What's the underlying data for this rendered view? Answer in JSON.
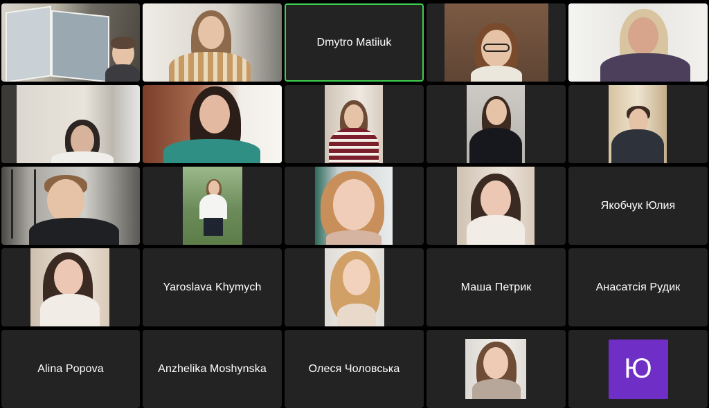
{
  "participants": {
    "p01": {
      "name": ""
    },
    "p02": {
      "name": ""
    },
    "p03": {
      "name": "Dmytro Matiiuk"
    },
    "p04": {
      "name": ""
    },
    "p05": {
      "name": ""
    },
    "p06": {
      "name": ""
    },
    "p07": {
      "name": ""
    },
    "p08": {
      "name": ""
    },
    "p09": {
      "name": ""
    },
    "p10": {
      "name": ""
    },
    "p11": {
      "name": ""
    },
    "p12": {
      "name": ""
    },
    "p13": {
      "name": ""
    },
    "p14": {
      "name": ""
    },
    "p15": {
      "name": "Якобчук Юлия"
    },
    "p16": {
      "name": ""
    },
    "p17": {
      "name": "Yaroslava Khymych"
    },
    "p18": {
      "name": ""
    },
    "p19": {
      "name": "Маша Петрик"
    },
    "p20": {
      "name": "Анасатсія Рудик"
    },
    "p21": {
      "name": "Alina Popova"
    },
    "p22": {
      "name": "Anzhelika Moshynska"
    },
    "p23": {
      "name": "Олеся Чоловська"
    },
    "p24": {
      "name": ""
    },
    "p25": {
      "name": "",
      "avatar_letter": "Ю",
      "avatar_color": "#6f2fc6"
    }
  },
  "colors": {
    "background": "#000000",
    "tile": "#232323",
    "active_speaker_border": "#3ecf4f"
  }
}
